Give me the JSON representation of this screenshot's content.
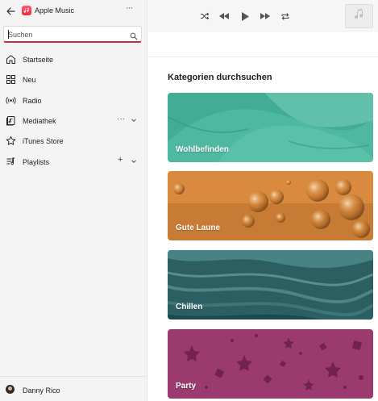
{
  "app": {
    "title": "Apple Music",
    "more": "···"
  },
  "search": {
    "placeholder": "Suchen"
  },
  "nav": {
    "items": [
      {
        "label": "Startseite",
        "icon": "home-icon"
      },
      {
        "label": "Neu",
        "icon": "grid-icon"
      },
      {
        "label": "Radio",
        "icon": "radio-icon"
      },
      {
        "label": "Mediathek",
        "icon": "library-icon",
        "more": "···",
        "chevron": "chevron-down-icon"
      },
      {
        "label": "iTunes Store",
        "icon": "star-icon"
      },
      {
        "label": "Playlists",
        "icon": "playlist-icon",
        "add": "+",
        "chevron": "chevron-down-icon"
      }
    ]
  },
  "user": {
    "name": "Danny Rico"
  },
  "player": {
    "controls": [
      "shuffle-icon",
      "previous-icon",
      "play-icon",
      "next-icon",
      "repeat-icon"
    ],
    "artwork_icon": "music-note-icon"
  },
  "main": {
    "section_title": "Kategorien durchsuchen",
    "categories": [
      {
        "label": "Wohlbefinden",
        "color": "#4fb8a0"
      },
      {
        "label": "Gute Laune",
        "color": "#d98a3f"
      },
      {
        "label": "Chillen",
        "color": "#2c5f62"
      },
      {
        "label": "Party",
        "color": "#9b3a6e"
      }
    ]
  },
  "colors": {
    "accent": "#fa233b",
    "search_underline": "#c72c41",
    "sidebar_bg": "#f4f4f4"
  }
}
